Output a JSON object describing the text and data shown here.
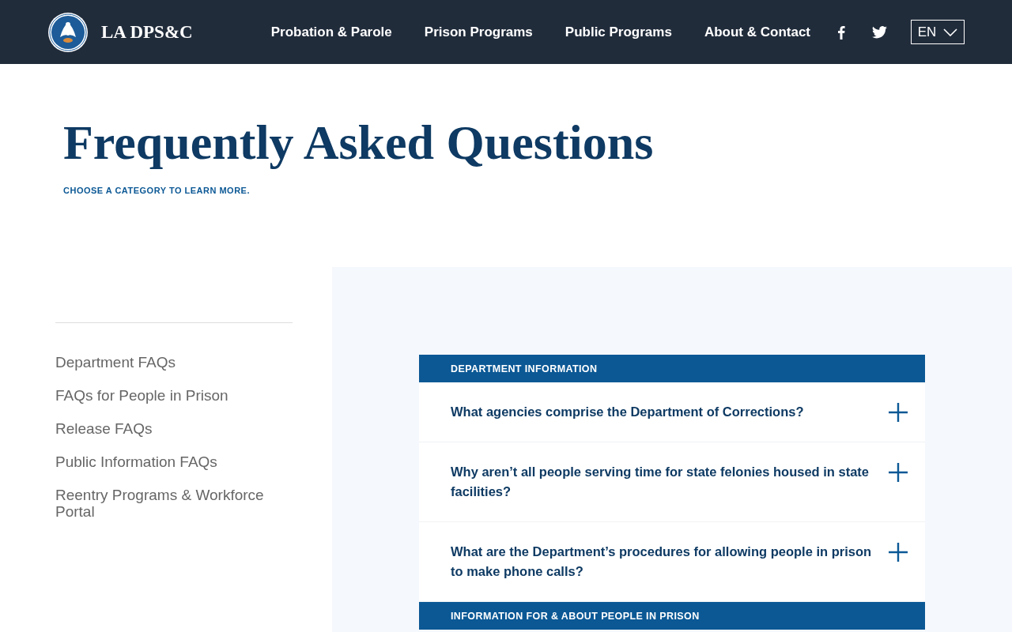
{
  "header": {
    "site_name": "LA DPS&C",
    "nav": [
      "Probation & Parole",
      "Prison Programs",
      "Public Programs",
      "About & Contact"
    ],
    "language": "EN"
  },
  "page": {
    "title": "Frequently Asked Questions",
    "subtitle": "CHOOSE A CATEGORY TO LEARN MORE."
  },
  "sidebar": {
    "items": [
      {
        "label": "Department FAQs"
      },
      {
        "label": "FAQs for People in Prison"
      },
      {
        "label": "Release FAQs"
      },
      {
        "label": "Public Information FAQs"
      },
      {
        "label": "Reentry Programs & Workforce Portal"
      }
    ]
  },
  "faq_sections": [
    {
      "heading": "DEPARTMENT INFORMATION",
      "questions": [
        {
          "text": "What agencies comprise the Department of Corrections?",
          "expanded": false
        },
        {
          "text": "Why aren’t all people serving time for state felonies housed in state facilities?",
          "expanded": false
        },
        {
          "text": "What are the Department’s procedures for allowing people in prison to make phone calls?",
          "expanded": false
        }
      ]
    },
    {
      "heading": "INFORMATION FOR & ABOUT PEOPLE IN PRISON"
    }
  ]
}
